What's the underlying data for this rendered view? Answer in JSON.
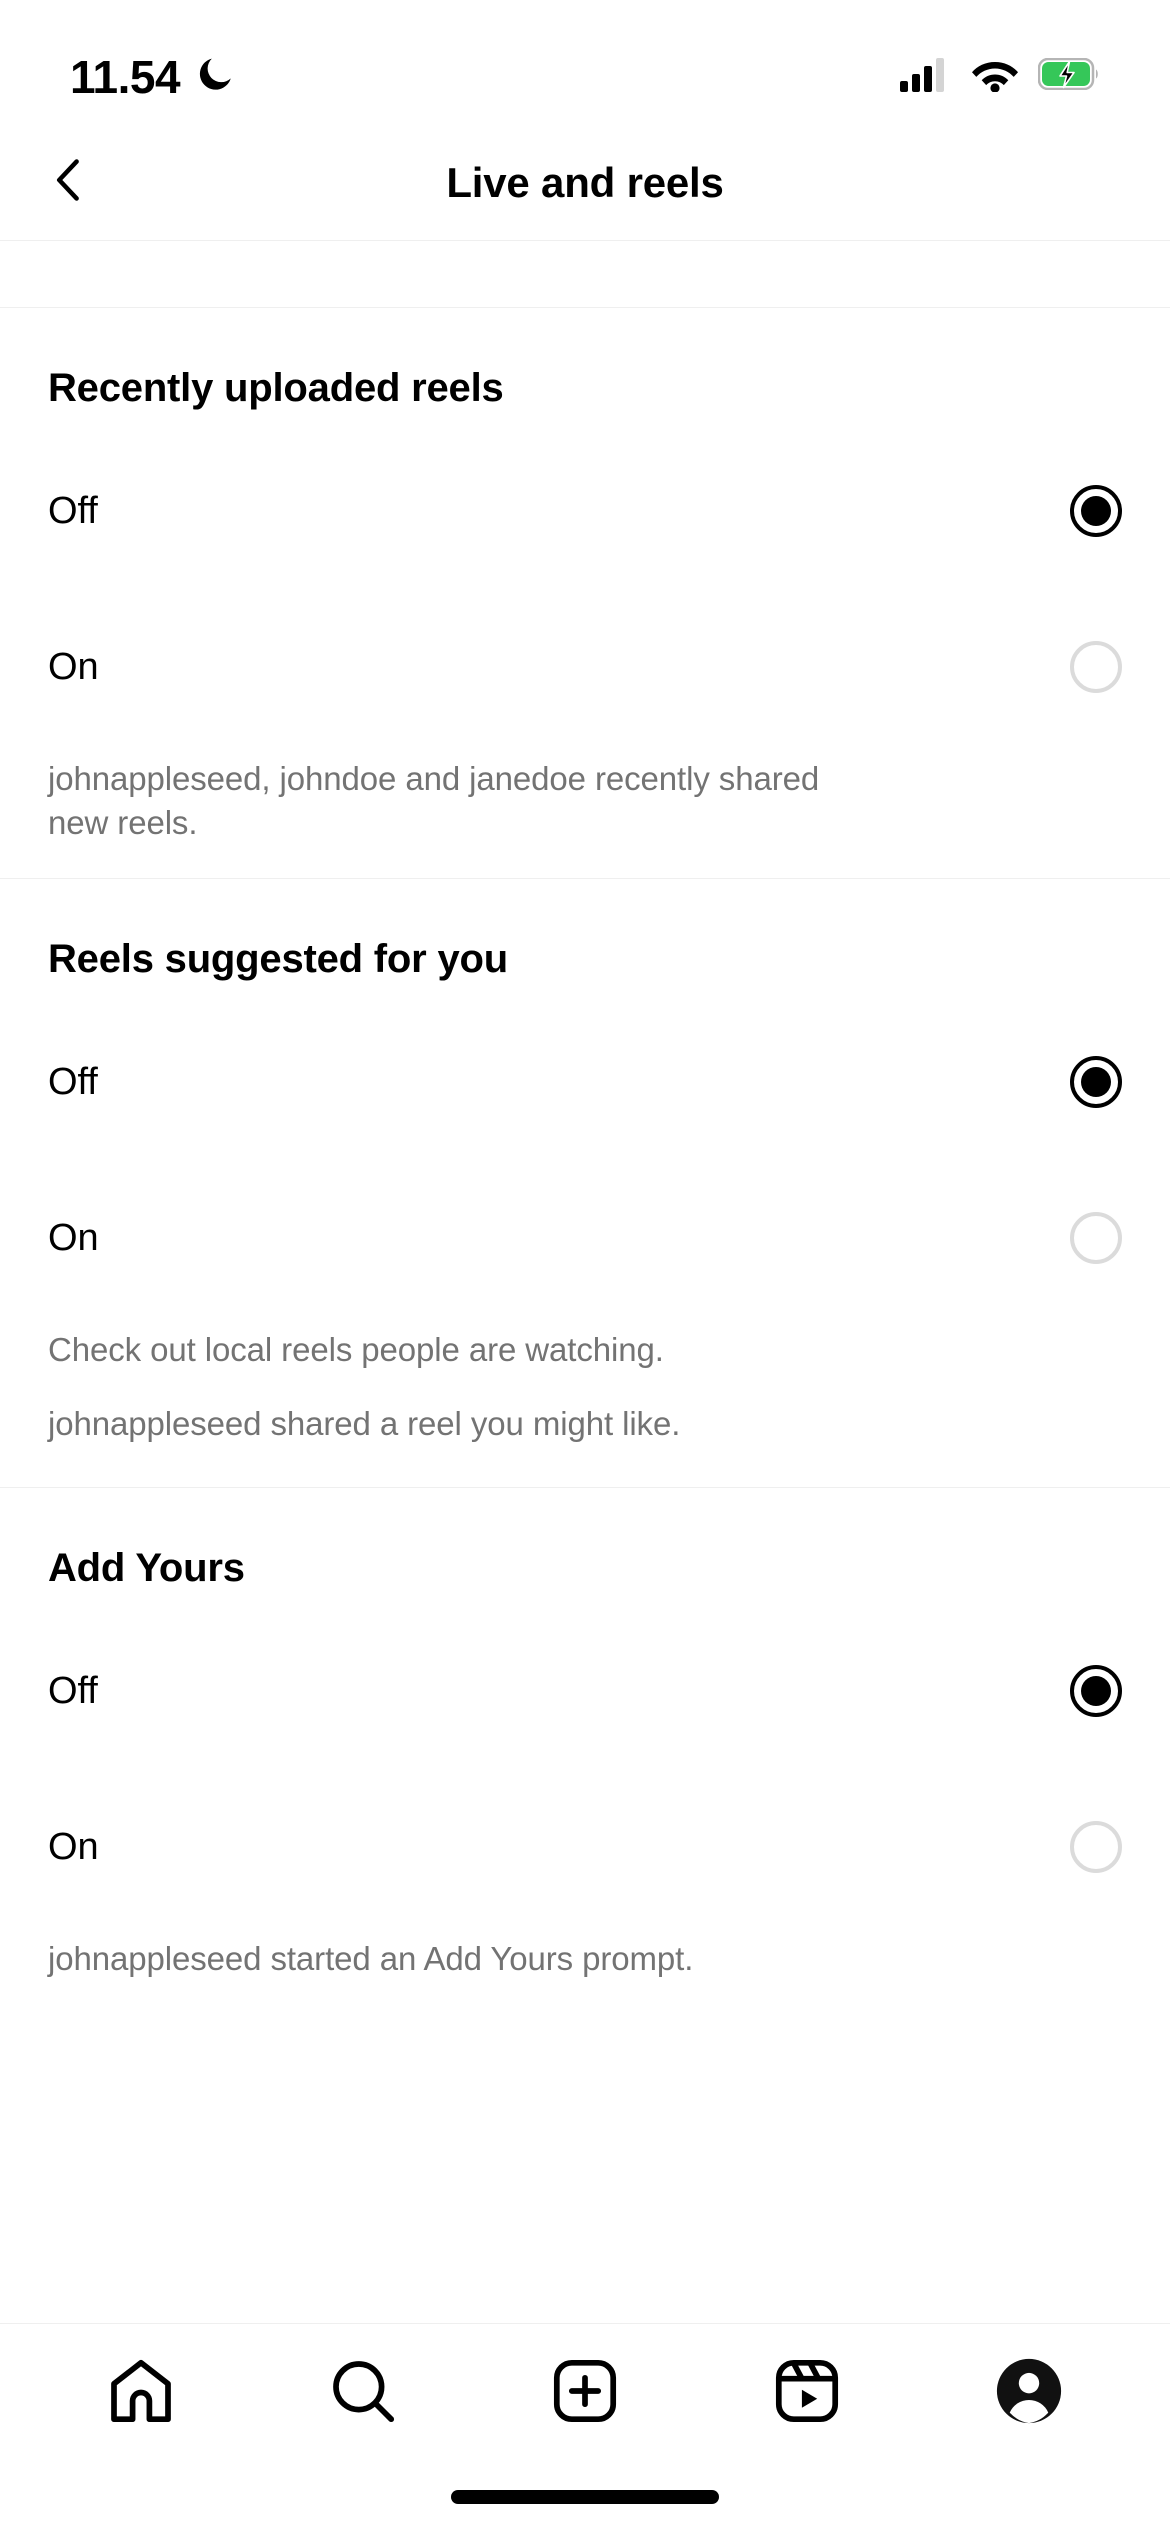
{
  "status_bar": {
    "time": "11.54",
    "moon_icon": "crescent-moon-icon",
    "signal_icon": "cellular-signal-icon",
    "wifi_icon": "wifi-icon",
    "battery_icon": "battery-charging-icon",
    "battery_color": "#35C759"
  },
  "header": {
    "back_icon": "chevron-left-icon",
    "title": "Live and reels"
  },
  "colors": {
    "text_primary": "#000000",
    "text_secondary": "#737373",
    "divider": "#efefef",
    "radio_unselected": "#dbdbdb",
    "radio_selected": "#000000"
  },
  "sections": [
    {
      "title": "Recently uploaded reels",
      "options": [
        {
          "label": "Off",
          "selected": true
        },
        {
          "label": "On",
          "selected": false
        }
      ],
      "descriptions": [
        "johnappleseed, johndoe and janedoe recently shared new reels."
      ]
    },
    {
      "title": "Reels suggested for you",
      "options": [
        {
          "label": "Off",
          "selected": true
        },
        {
          "label": "On",
          "selected": false
        }
      ],
      "descriptions": [
        "Check out local reels people are watching.",
        "johnappleseed shared a reel you might like."
      ]
    },
    {
      "title": "Add Yours",
      "options": [
        {
          "label": "Off",
          "selected": true
        },
        {
          "label": "On",
          "selected": false
        }
      ],
      "descriptions": [
        "johnappleseed started an Add Yours prompt."
      ]
    }
  ],
  "tabbar": {
    "items": [
      {
        "name": "home-icon",
        "label": "Home"
      },
      {
        "name": "search-icon",
        "label": "Search"
      },
      {
        "name": "create-icon",
        "label": "Create"
      },
      {
        "name": "reels-icon",
        "label": "Reels"
      },
      {
        "name": "profile-icon",
        "label": "Profile"
      }
    ]
  }
}
